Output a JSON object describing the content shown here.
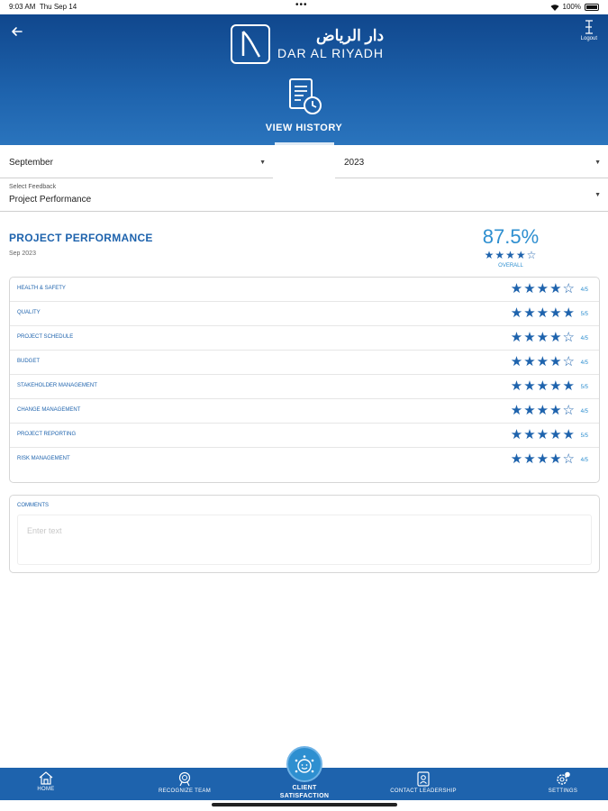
{
  "status_bar": {
    "time": "9:03 AM",
    "day": "Thu Sep 14",
    "battery": "100%"
  },
  "header": {
    "brand_ar": "دار الرياض",
    "brand_en": "DAR AL RIYADH",
    "logout_label": "Logout",
    "view_history_label": "VIEW HISTORY"
  },
  "filters": {
    "month": "September",
    "year": "2023",
    "feedback_label": "Select Feedback",
    "feedback_value": "Project Performance"
  },
  "summary": {
    "title": "PROJECT PERFORMANCE",
    "date": "Sep 2023",
    "overall_percent": "87.5%",
    "overall_label": "OVERALL",
    "overall_stars": 4
  },
  "ratings": [
    {
      "name": "HEALTH & SAFETY",
      "stars": 4,
      "score": "4/5"
    },
    {
      "name": "QUALITY",
      "stars": 5,
      "score": "5/5"
    },
    {
      "name": "PROJECT SCHEDULE",
      "stars": 4,
      "score": "4/5"
    },
    {
      "name": "BUDGET",
      "stars": 4,
      "score": "4/5"
    },
    {
      "name": "STAKEHOLDER MANAGEMENT",
      "stars": 5,
      "score": "5/5"
    },
    {
      "name": "CHANGE MANAGEMENT",
      "stars": 4,
      "score": "4/5"
    },
    {
      "name": "PROJECT REPORTING",
      "stars": 5,
      "score": "5/5"
    },
    {
      "name": "RISK MANAGEMENT",
      "stars": 4,
      "score": "4/5"
    }
  ],
  "comments": {
    "label": "COMMENTS",
    "placeholder": "Enter text"
  },
  "nav": {
    "home": "HOME",
    "recognize_team": "RECOGNIZE TEAM",
    "client_satisfaction": "CLIENT SATISFACTION",
    "contact_leadership": "CONTACT LEADERSHIP",
    "settings": "SETTINGS"
  },
  "colors": {
    "primary": "#1e63ad",
    "accent": "#2e8fd0",
    "header_dark": "#10478d"
  }
}
